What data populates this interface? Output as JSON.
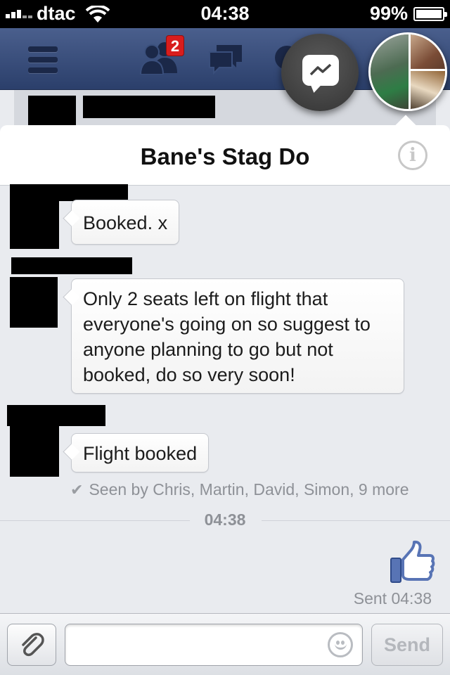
{
  "status_bar": {
    "carrier": "dtac",
    "time": "04:38",
    "battery": "99%"
  },
  "nav": {
    "friend_requests_badge": "2"
  },
  "chat": {
    "title": "Bane's Stag Do",
    "messages": [
      {
        "text": "Booked. x"
      },
      {
        "text": "Only 2 seats left on flight that everyone's going on so suggest to anyone planning to go but not booked, do so very soon!"
      },
      {
        "text": "Flight booked"
      }
    ],
    "seen_by": "Seen by Chris, Martin, David, Simon, 9 more",
    "time_separator": "04:38",
    "sent_status": "Sent 04:38"
  },
  "compose": {
    "input_value": "",
    "send_label": "Send"
  },
  "icons": {
    "menu": "hamburger-icon",
    "friends": "friends-icon",
    "messages": "messages-icon",
    "notifications": "globe-icon",
    "messenger": "messenger-bolt-icon",
    "info": "info-icon",
    "like": "thumbs-up-icon",
    "attach": "paperclip-icon",
    "emoji": "smiley-icon"
  },
  "colors": {
    "nav_bar": "#3b5284",
    "badge": "#d81d1d",
    "like_icon": "#5874b5",
    "background": "#e9ebef"
  }
}
